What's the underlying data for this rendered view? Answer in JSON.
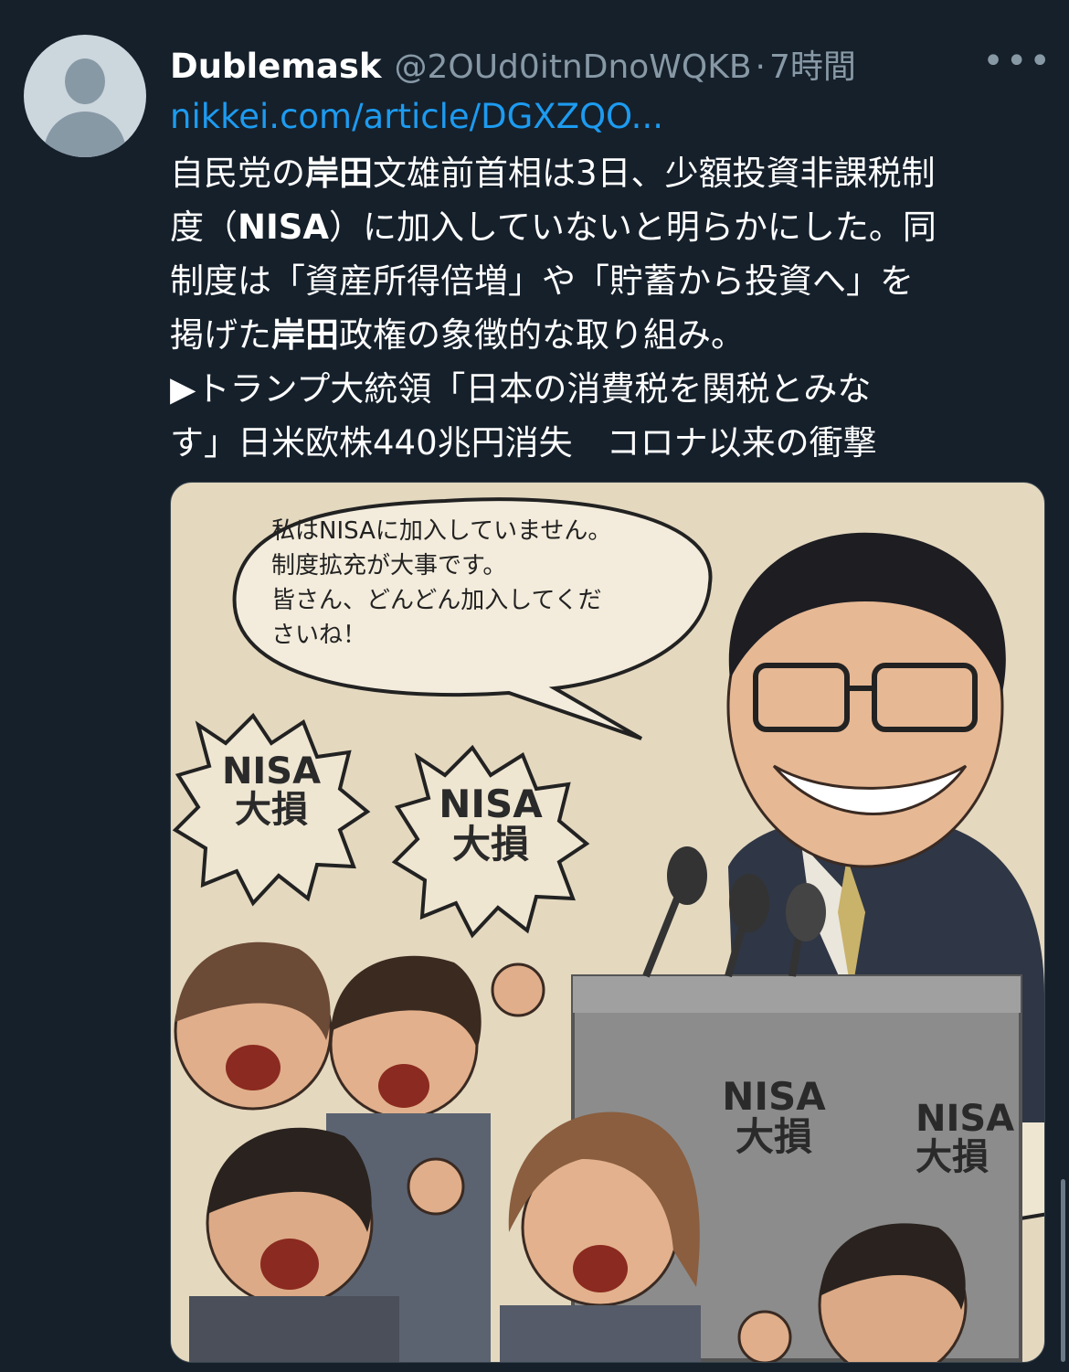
{
  "tweet": {
    "author_name": "Dublemask",
    "author_handle": "@2OUd0itnDnoWQKB",
    "separator": "·",
    "timestamp": "7時間",
    "more_icon": "more-dots-icon",
    "link_text": "nikkei.com/article/DGXZQO...",
    "text": {
      "l1a": "自民党の",
      "l1b": "岸田",
      "l1c": "文雄前首相は3日、少額投資非課税制",
      "l2a": "度（",
      "l2b": "NISA",
      "l2c": "）に加入していないと明らかにした。同",
      "l3": "制度は「資産所得倍増」や「貯蓄から投資へ」を",
      "l4a": "掲げた",
      "l4b": "岸田",
      "l4c": "政権の象徴的な取り組み。",
      "l5": "▶トランプ大統領「日本の消費税を関税とみな",
      "l6": "す」日米欧株440兆円消失　コロナ以来の衝撃"
    }
  },
  "image": {
    "speech": {
      "line1": "私はNISAに加入していません。",
      "line2": "制度拡充が大事です。",
      "line3": "皆さん、どんどん加入してくだ",
      "line4": "さいね！"
    },
    "shouts": [
      {
        "l1": "NISA",
        "l2": "大損"
      },
      {
        "l1": "NISA",
        "l2": "大損"
      },
      {
        "l1": "NISA",
        "l2": "大損"
      },
      {
        "l1": "NISA",
        "l2": "大損"
      }
    ]
  }
}
